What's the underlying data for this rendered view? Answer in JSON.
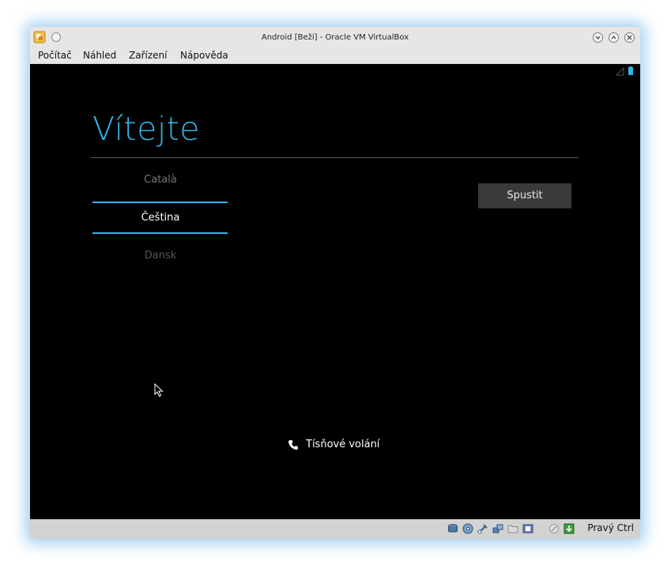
{
  "window": {
    "title": "Android [Beží] - Oracle VM VirtualBox"
  },
  "menu": [
    "Počítač",
    "Náhled",
    "Zařízení",
    "Nápověda"
  ],
  "setup": {
    "welcome": "Vítejte",
    "languages": [
      {
        "label": "Català",
        "selected": false
      },
      {
        "label": "Čeština",
        "selected": true
      },
      {
        "label": "Dansk",
        "selected": false
      }
    ],
    "start_button": "Spustit",
    "emergency_call": "Tísňové volání"
  },
  "statusbar": {
    "icons": [
      "hard-disk-icon",
      "optical-drive-icon",
      "usb-icon",
      "network-icon",
      "shared-folder-icon",
      "video-capture-icon",
      "mouse-integration-icon",
      "keyboard-icon"
    ],
    "host_key": "Pravý Ctrl"
  },
  "colors": {
    "accent": "#33b5e5",
    "background": "#000000",
    "button": "#3a3a3a"
  }
}
